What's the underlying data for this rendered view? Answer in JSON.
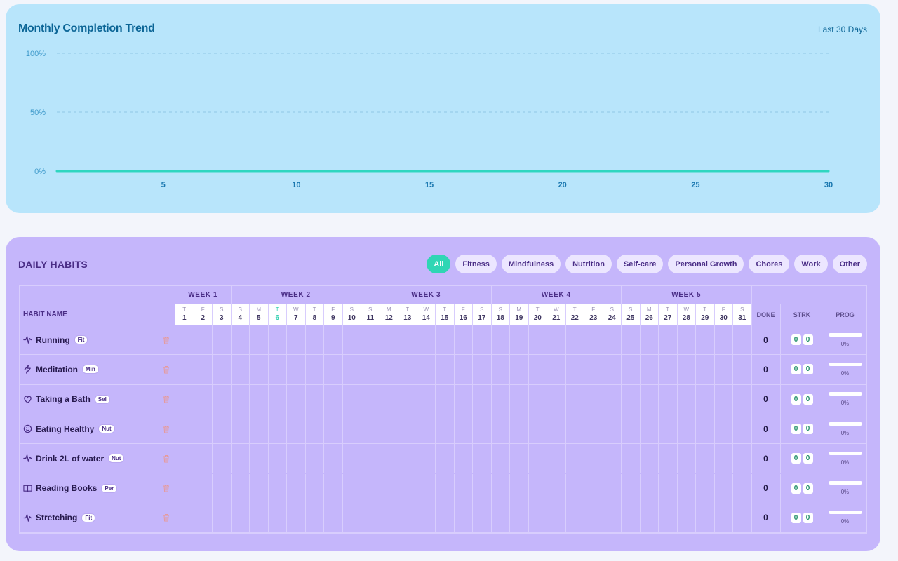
{
  "trend": {
    "title": "Monthly Completion Trend",
    "range_label": "Last 30 Days"
  },
  "chart_data": {
    "type": "line",
    "title": "Monthly Completion Trend",
    "x": [
      1,
      2,
      3,
      4,
      5,
      6,
      7,
      8,
      9,
      10,
      11,
      12,
      13,
      14,
      15,
      16,
      17,
      18,
      19,
      20,
      21,
      22,
      23,
      24,
      25,
      26,
      27,
      28,
      29,
      30
    ],
    "series": [
      {
        "values": [
          0,
          0,
          0,
          0,
          0,
          0,
          0,
          0,
          0,
          0,
          0,
          0,
          0,
          0,
          0,
          0,
          0,
          0,
          0,
          0,
          0,
          0,
          0,
          0,
          0,
          0,
          0,
          0,
          0,
          0
        ]
      }
    ],
    "x_ticks": [
      "5",
      "10",
      "15",
      "20",
      "25",
      "30"
    ],
    "y_ticks": [
      "0%",
      "50%",
      "100%"
    ],
    "xlim": [
      1,
      30
    ],
    "ylim": [
      0,
      100
    ],
    "grid": true,
    "colors": {
      "line": "#2fd6c0",
      "grid": "#8fc7e6",
      "tick": "#1a78b0"
    }
  },
  "habits": {
    "title": "DAILY HABITS",
    "filters": [
      {
        "label": "All",
        "active": true
      },
      {
        "label": "Fitness"
      },
      {
        "label": "Mindfulness"
      },
      {
        "label": "Nutrition"
      },
      {
        "label": "Self-care"
      },
      {
        "label": "Personal Growth"
      },
      {
        "label": "Chores"
      },
      {
        "label": "Work"
      },
      {
        "label": "Other"
      }
    ],
    "weeks": [
      "WEEK 1",
      "WEEK 2",
      "WEEK 3",
      "WEEK 4",
      "WEEK 5"
    ],
    "days": [
      {
        "w": "T",
        "d": "1"
      },
      {
        "w": "F",
        "d": "2"
      },
      {
        "w": "S",
        "d": "3"
      },
      {
        "w": "S",
        "d": "4"
      },
      {
        "w": "M",
        "d": "5"
      },
      {
        "w": "T",
        "d": "6",
        "today": true
      },
      {
        "w": "W",
        "d": "7"
      },
      {
        "w": "T",
        "d": "8"
      },
      {
        "w": "F",
        "d": "9"
      },
      {
        "w": "S",
        "d": "10"
      },
      {
        "w": "S",
        "d": "11"
      },
      {
        "w": "M",
        "d": "12"
      },
      {
        "w": "T",
        "d": "13"
      },
      {
        "w": "W",
        "d": "14"
      },
      {
        "w": "T",
        "d": "15"
      },
      {
        "w": "F",
        "d": "16"
      },
      {
        "w": "S",
        "d": "17"
      },
      {
        "w": "S",
        "d": "18"
      },
      {
        "w": "M",
        "d": "19"
      },
      {
        "w": "T",
        "d": "20"
      },
      {
        "w": "W",
        "d": "21"
      },
      {
        "w": "T",
        "d": "22"
      },
      {
        "w": "F",
        "d": "23"
      },
      {
        "w": "S",
        "d": "24"
      },
      {
        "w": "S",
        "d": "25"
      },
      {
        "w": "M",
        "d": "26"
      },
      {
        "w": "T",
        "d": "27"
      },
      {
        "w": "W",
        "d": "28"
      },
      {
        "w": "T",
        "d": "29"
      },
      {
        "w": "F",
        "d": "30"
      },
      {
        "w": "S",
        "d": "31"
      }
    ],
    "headers": {
      "name": "HABIT NAME",
      "done": "DONE",
      "strk": "STRK",
      "prog": "PROG"
    },
    "rows": [
      {
        "name": "Running",
        "tag": "Fit",
        "icon": "activity-icon",
        "done": "0",
        "streak_current": "0",
        "streak_best": "0",
        "progress": 0,
        "progress_label": "0%"
      },
      {
        "name": "Meditation",
        "tag": "Min",
        "icon": "bolt-icon",
        "done": "0",
        "streak_current": "0",
        "streak_best": "0",
        "progress": 0,
        "progress_label": "0%"
      },
      {
        "name": "Taking a Bath",
        "tag": "Sel",
        "icon": "heart-icon",
        "done": "0",
        "streak_current": "0",
        "streak_best": "0",
        "progress": 0,
        "progress_label": "0%"
      },
      {
        "name": "Eating Healthy",
        "tag": "Nut",
        "icon": "smile-icon",
        "done": "0",
        "streak_current": "0",
        "streak_best": "0",
        "progress": 0,
        "progress_label": "0%"
      },
      {
        "name": "Drink 2L of water",
        "tag": "Nut",
        "icon": "activity-icon",
        "done": "0",
        "streak_current": "0",
        "streak_best": "0",
        "progress": 0,
        "progress_label": "0%"
      },
      {
        "name": "Reading Books",
        "tag": "Per",
        "icon": "book-icon",
        "done": "0",
        "streak_current": "0",
        "streak_best": "0",
        "progress": 0,
        "progress_label": "0%"
      },
      {
        "name": "Stretching",
        "tag": "Fit",
        "icon": "activity-icon",
        "done": "0",
        "streak_current": "0",
        "streak_best": "0",
        "progress": 0,
        "progress_label": "0%"
      }
    ]
  }
}
